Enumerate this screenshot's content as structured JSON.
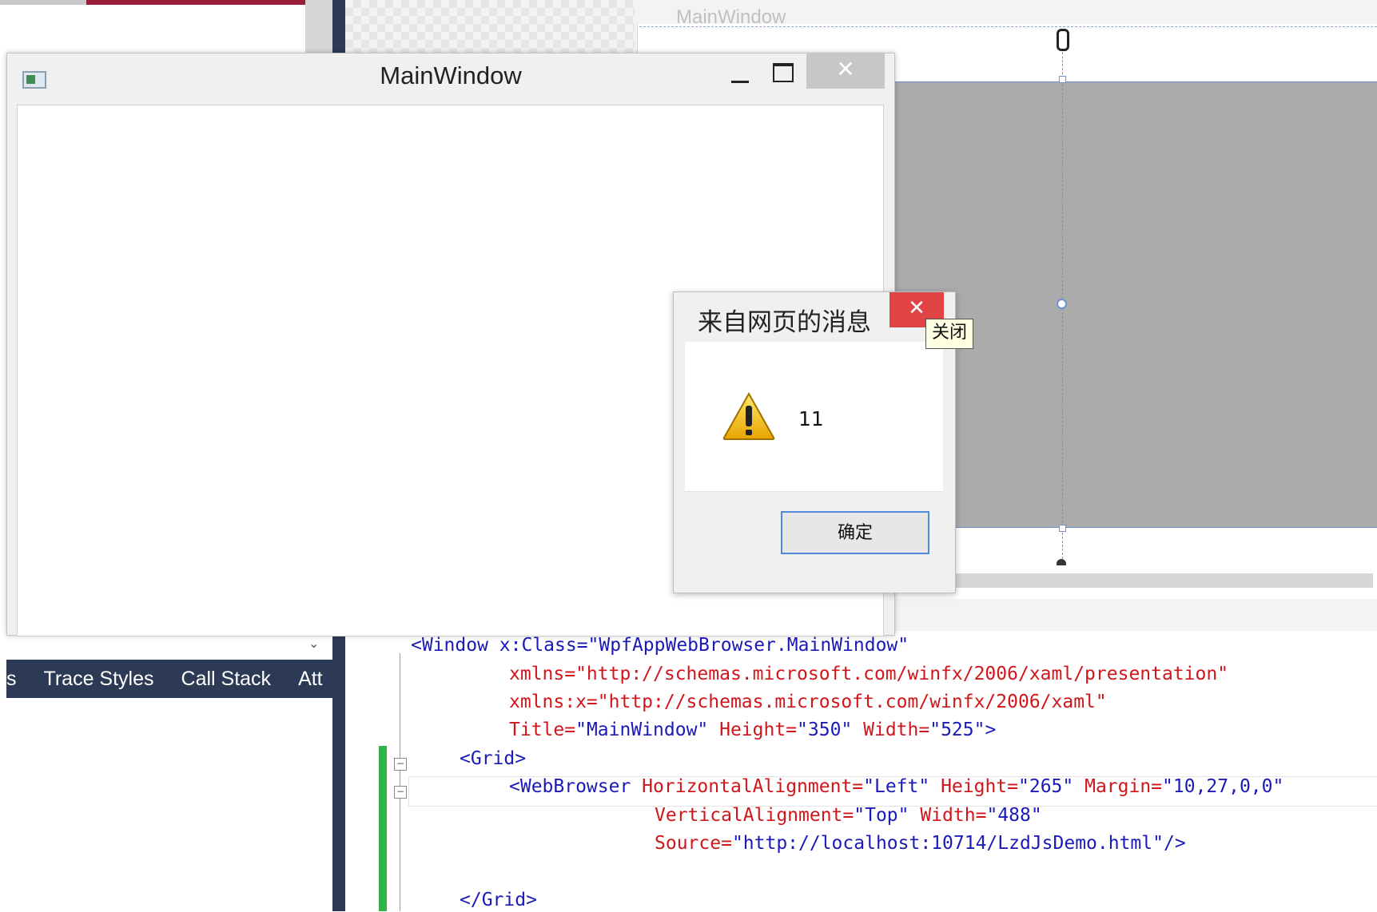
{
  "designer": {
    "window_title": "MainWindow"
  },
  "tool_window": {
    "tabs": [
      "s",
      "Trace Styles",
      "Call Stack",
      "Att"
    ],
    "chevron": "⌄"
  },
  "code": {
    "lines": [
      {
        "text": "<Window x:Class=\"WpfAppWebBrowser.MainWindow\""
      },
      {
        "text": "xmlns=\"http://schemas.microsoft.com/winfx/2006/xaml/presentation\""
      },
      {
        "text": "xmlns:x=\"http://schemas.microsoft.com/winfx/2006/xaml\""
      },
      {
        "attr1": "Title=",
        "val1": "\"MainWindow\"",
        "attr2": " Height=",
        "val2": "\"350\"",
        "attr3": " Width=",
        "val3": "\"525\"",
        "end": ">"
      },
      {
        "text": "<Grid>"
      },
      {
        "tag": "<WebBrowser",
        "attr1": " HorizontalAlignment=",
        "val1": "\"Left\"",
        "attr2": " Height=",
        "val2": "\"265\"",
        "attr3": " Margin=",
        "val3": "\"10,27,0,0\""
      },
      {
        "attr1": "VerticalAlignment=",
        "val1": "\"Top\"",
        "attr2": " Width=",
        "val2": "\"488\""
      },
      {
        "attr1": "Source=",
        "val1": "\"http://localhost:10714/LzdJsDemo.html\"",
        "end": "/>"
      },
      {
        "text": "</Grid>"
      }
    ],
    "fold_symbol": "−"
  },
  "main_window": {
    "title": "MainWindow",
    "close_glyph": "✕"
  },
  "message_dialog": {
    "title": "来自网页的消息",
    "close_glyph": "✕",
    "message": "11",
    "ok_label": "确定",
    "tooltip": "关闭"
  }
}
